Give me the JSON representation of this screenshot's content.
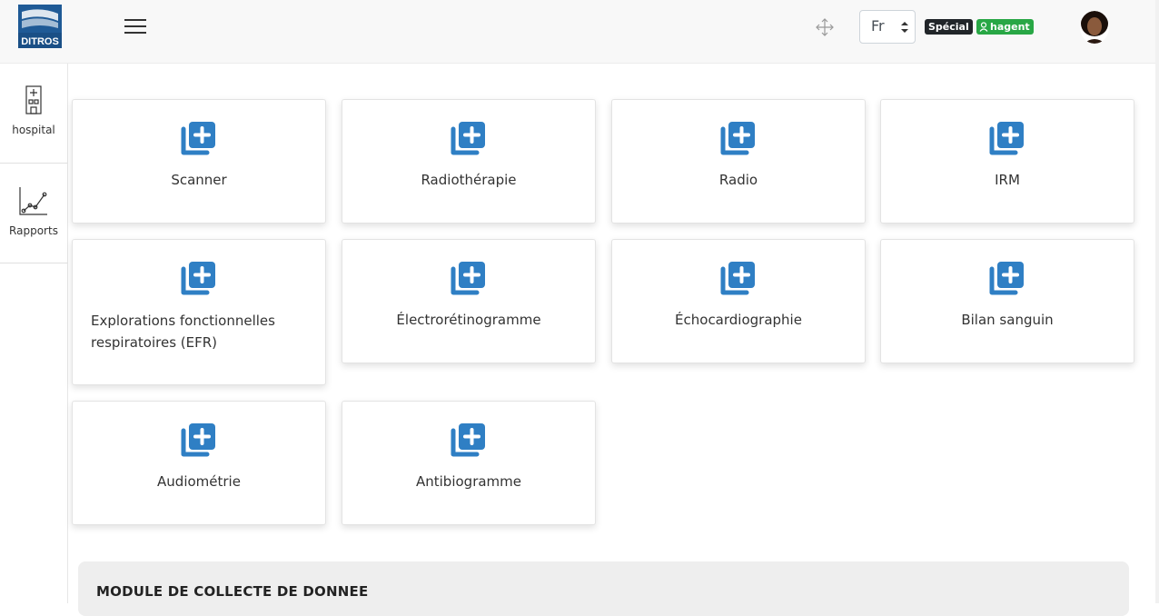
{
  "header": {
    "logo_text": "DITROS",
    "language": "Fr",
    "badge_role": "Spécial",
    "badge_user": "hagent"
  },
  "sidebar": {
    "items": [
      {
        "label": "hospital",
        "icon": "hospital-icon"
      },
      {
        "label": "Rapports",
        "icon": "chart-line-icon"
      }
    ]
  },
  "cards": [
    {
      "label": "Scanner"
    },
    {
      "label": "Radiothérapie"
    },
    {
      "label": "Radio"
    },
    {
      "label": "IRM"
    },
    {
      "label": "Explorations fonctionnelles respiratoires (EFR)"
    },
    {
      "label": "Électrorétinogramme"
    },
    {
      "label": "Échocardiographie"
    },
    {
      "label": "Bilan sanguin"
    },
    {
      "label": "Audiométrie"
    },
    {
      "label": "Antibiogramme"
    }
  ],
  "module": {
    "title": "MODULE DE COLLECTE DE DONNEE"
  },
  "colors": {
    "accent": "#2f7fc4",
    "badge_dark": "#212529",
    "badge_green": "#28a745"
  }
}
